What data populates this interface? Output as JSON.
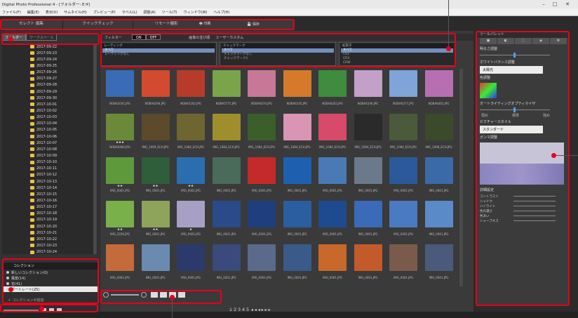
{
  "window": {
    "title": "Digital Photo Professional 4 - [フォルダー: E:¥]",
    "minimize": "–",
    "maximize": "□",
    "close": "✕"
  },
  "menu": [
    "ファイル(F)",
    "編集(E)",
    "表示(V)",
    "サムネイル(H)",
    "プレビュー(P)",
    "ラベル(L)",
    "調整(A)",
    "ツール(T)",
    "ウィンドウ(W)",
    "ヘルプ(H)"
  ],
  "toolbar": {
    "tabs": [
      "セレクト 編集",
      "クイックチェック",
      "リモート撮影"
    ],
    "print_label": "印刷",
    "save_label": "保存"
  },
  "left_panel": {
    "tab_folder": "フォルダー",
    "tab_workspace": "ワークスペース",
    "folders": [
      "2017-09-22",
      "2017-09-23",
      "2017-09-24",
      "2017-09-25",
      "2017-09-26",
      "2017-09-27",
      "2017-09-28",
      "2017-09-29",
      "2017-09-30",
      "2017-10-01",
      "2017-10-02",
      "2017-10-03",
      "2017-10-04",
      "2017-10-05",
      "2017-10-06",
      "2017-10-07",
      "2017-10-08",
      "2017-10-09",
      "2017-10-10",
      "2017-10-11",
      "2017-10-12",
      "2017-10-13",
      "2017-10-14",
      "2017-10-15",
      "2017-10-16",
      "2017-10-17",
      "2017-10-18",
      "2017-10-19",
      "2017-10-20",
      "2017-10-21",
      "2017-10-22",
      "2017-10-23",
      "2017-10-24",
      "2017-10-25",
      "2017-10-26"
    ],
    "collection_title": "コレクション",
    "collections": [
      {
        "label": "新しいコレクション(0)",
        "selected": false
      },
      {
        "label": "風景(14)",
        "selected": false
      },
      {
        "label": "花(41)",
        "selected": false
      },
      {
        "label": "ポートレート(25)",
        "selected": true
      }
    ],
    "add_collection": "コレクションの追加"
  },
  "filter": {
    "label": "フィルター",
    "on": "ON",
    "off": "OFF",
    "image_sort": "画像の並び順",
    "user_custom": "ユーザーカスタム",
    "rating": {
      "head": "レーティング",
      "rows": [
        "すべて",
        "レーティングなし"
      ]
    },
    "check": {
      "head": "チェックマーク",
      "rows": [
        "すべて",
        "チェックマークなし",
        "チェックマーク1"
      ]
    },
    "ext": {
      "head": "拡張子",
      "rows": [
        "すべて",
        "CR2",
        "CR3",
        "CRW"
      ]
    }
  },
  "thumbnails": [
    {
      "cap": "NOBA2041.JPG",
      "color": "#3a6bb5",
      "stars": ""
    },
    {
      "cap": "NOBA4294.JPG",
      "color": "#d24a2f",
      "stars": ""
    },
    {
      "cap": "NOBA5302.JPG",
      "color": "#b63b2a",
      "stars": ""
    },
    {
      "cap": "NOBA5775.JPG",
      "color": "#7aa44a",
      "stars": ""
    },
    {
      "cap": "NOBA6074.JPG",
      "color": "#c77896",
      "stars": ""
    },
    {
      "cap": "NOBA6145.JPG",
      "color": "#d47a2a",
      "stars": ""
    },
    {
      "cap": "NOBA6202.JPG",
      "color": "#3f8c3e",
      "stars": ""
    },
    {
      "cap": "NOBA6346.JPG",
      "color": "#c2a0c8",
      "stars": ""
    },
    {
      "cap": "NOBA6377.JPG",
      "color": "#7ea4d8",
      "stars": ""
    },
    {
      "cap": "NOBA6463.JPG",
      "color": "#b86fb2",
      "stars": ""
    },
    {
      "cap": "NOBA6484.JPG",
      "color": "#6a8a3a",
      "stars": "★★★"
    },
    {
      "cap": "IMG_1069_ECH.JPG",
      "color": "#5c4a2a",
      "stars": ""
    },
    {
      "cap": "IMG_1084_ECH.JPG",
      "color": "#6e6530",
      "stars": ""
    },
    {
      "cap": "IMG_1084_ECH.JPG",
      "color": "#9e8f2c",
      "stars": ""
    },
    {
      "cap": "IMG_1084_ECH.JPG",
      "color": "#3b5e2a",
      "stars": ""
    },
    {
      "cap": "IMG_1084_ECH.JPG",
      "color": "#d995b4",
      "stars": ""
    },
    {
      "cap": "IMG_1084_ECH.JPG",
      "color": "#d84a6a",
      "stars": ""
    },
    {
      "cap": "IMG_1084_ECH.JPG",
      "color": "#2a2a2a",
      "stars": ""
    },
    {
      "cap": "IMG_1084_ECH.JPG",
      "color": "#4a5a3a",
      "stars": ""
    },
    {
      "cap": "IMG_1098_ECH.JPG",
      "color": "#3a4a2a",
      "stars": ""
    },
    {
      "cap": "IMG_0001.JPG",
      "color": "#5e9a3c",
      "stars": "★★"
    },
    {
      "cap": "IMG_0001.JPG",
      "color": "#2f5e3a",
      "stars": "★★"
    },
    {
      "cap": "IMG_0001.JPG",
      "color": "#2a6eb0",
      "stars": "★★"
    },
    {
      "cap": "IMG_0001.JPG",
      "color": "#4a6a5a",
      "stars": ""
    },
    {
      "cap": "IMG_0001.JPG",
      "color": "#c42a2a",
      "stars": ""
    },
    {
      "cap": "IMG_0001.JPG",
      "color": "#1e5fb0",
      "stars": ""
    },
    {
      "cap": "IMG_0001.JPG",
      "color": "#4a7ab5",
      "stars": ""
    },
    {
      "cap": "IMG_0001.JPG",
      "color": "#6a7a8a",
      "stars": ""
    },
    {
      "cap": "IMG_0001.JPG",
      "color": "#2a5a9a",
      "stars": ""
    },
    {
      "cap": "IMG_0001.JPG",
      "color": "#3a6aa8",
      "stars": ""
    },
    {
      "cap": "IMG_2226.JPG",
      "color": "#7ab04a",
      "stars": "★★"
    },
    {
      "cap": "IMG_0001.JPG",
      "color": "#8ea45a",
      "stars": "★★"
    },
    {
      "cap": "IMG_0001.JPG",
      "color": "#a7a0c4",
      "stars": "★"
    },
    {
      "cap": "IMG_0001.JPG",
      "color": "#2a4a8a",
      "stars": ""
    },
    {
      "cap": "IMG_0001.JPG",
      "color": "#1e3e7e",
      "stars": ""
    },
    {
      "cap": "IMG_0001.JPG",
      "color": "#2a5ea0",
      "stars": ""
    },
    {
      "cap": "IMG_0001.JPG",
      "color": "#1e4a90",
      "stars": ""
    },
    {
      "cap": "IMG_0001.JPG",
      "color": "#3a6ab8",
      "stars": ""
    },
    {
      "cap": "IMG_0001.JPG",
      "color": "#4a7ac0",
      "stars": ""
    },
    {
      "cap": "IMG_0001.JPG",
      "color": "#5a8ac8",
      "stars": ""
    },
    {
      "cap": "IMG_0001.JPG",
      "color": "#c56a3a",
      "stars": ""
    },
    {
      "cap": "IMG_0001.JPG",
      "color": "#6a8ab0",
      "stars": ""
    },
    {
      "cap": "IMG_0001.JPG",
      "color": "#2a3a6a",
      "stars": ""
    },
    {
      "cap": "IMG_0001.JPG",
      "color": "#3a4a7a",
      "stars": ""
    },
    {
      "cap": "IMG_0001.JPG",
      "color": "#5a6a8a",
      "stars": ""
    },
    {
      "cap": "IMG_0001.JPG",
      "color": "#3a5a8a",
      "stars": ""
    },
    {
      "cap": "IMG_0001.JPG",
      "color": "#c8682a",
      "stars": ""
    },
    {
      "cap": "IMG_0001.JPG",
      "color": "#c25a2a",
      "stars": ""
    },
    {
      "cap": "IMG_0001.JPG",
      "color": "#7a5a4a",
      "stars": ""
    },
    {
      "cap": "IMG_0001.JPG",
      "color": "#4a5a7a",
      "stars": ""
    }
  ],
  "right_panel": {
    "head": "ツールパレット",
    "brightness": "明るさ調整",
    "brightness_value": "0.00",
    "wb": "ホワイトバランス調整",
    "wb_mode": "太陽光",
    "color": "色調整",
    "auto_lighting": "オートライティングオプティマイザ",
    "auto_levels": [
      "弱め",
      "標準",
      "強め"
    ],
    "picture_style": "ピクチャースタイル",
    "picture_style_value": "スタンダード",
    "tone_curve": "ガンマ調整",
    "detail": "詳細設定",
    "sliders": [
      "コントラスト",
      "シャドウ",
      "ハイライト",
      "色の濃さ",
      "色あい",
      "シャープネス"
    ]
  },
  "bottom": {
    "nav": "１２３４５  ◂ ◂ ◂ ▸ ▸ ▸"
  }
}
